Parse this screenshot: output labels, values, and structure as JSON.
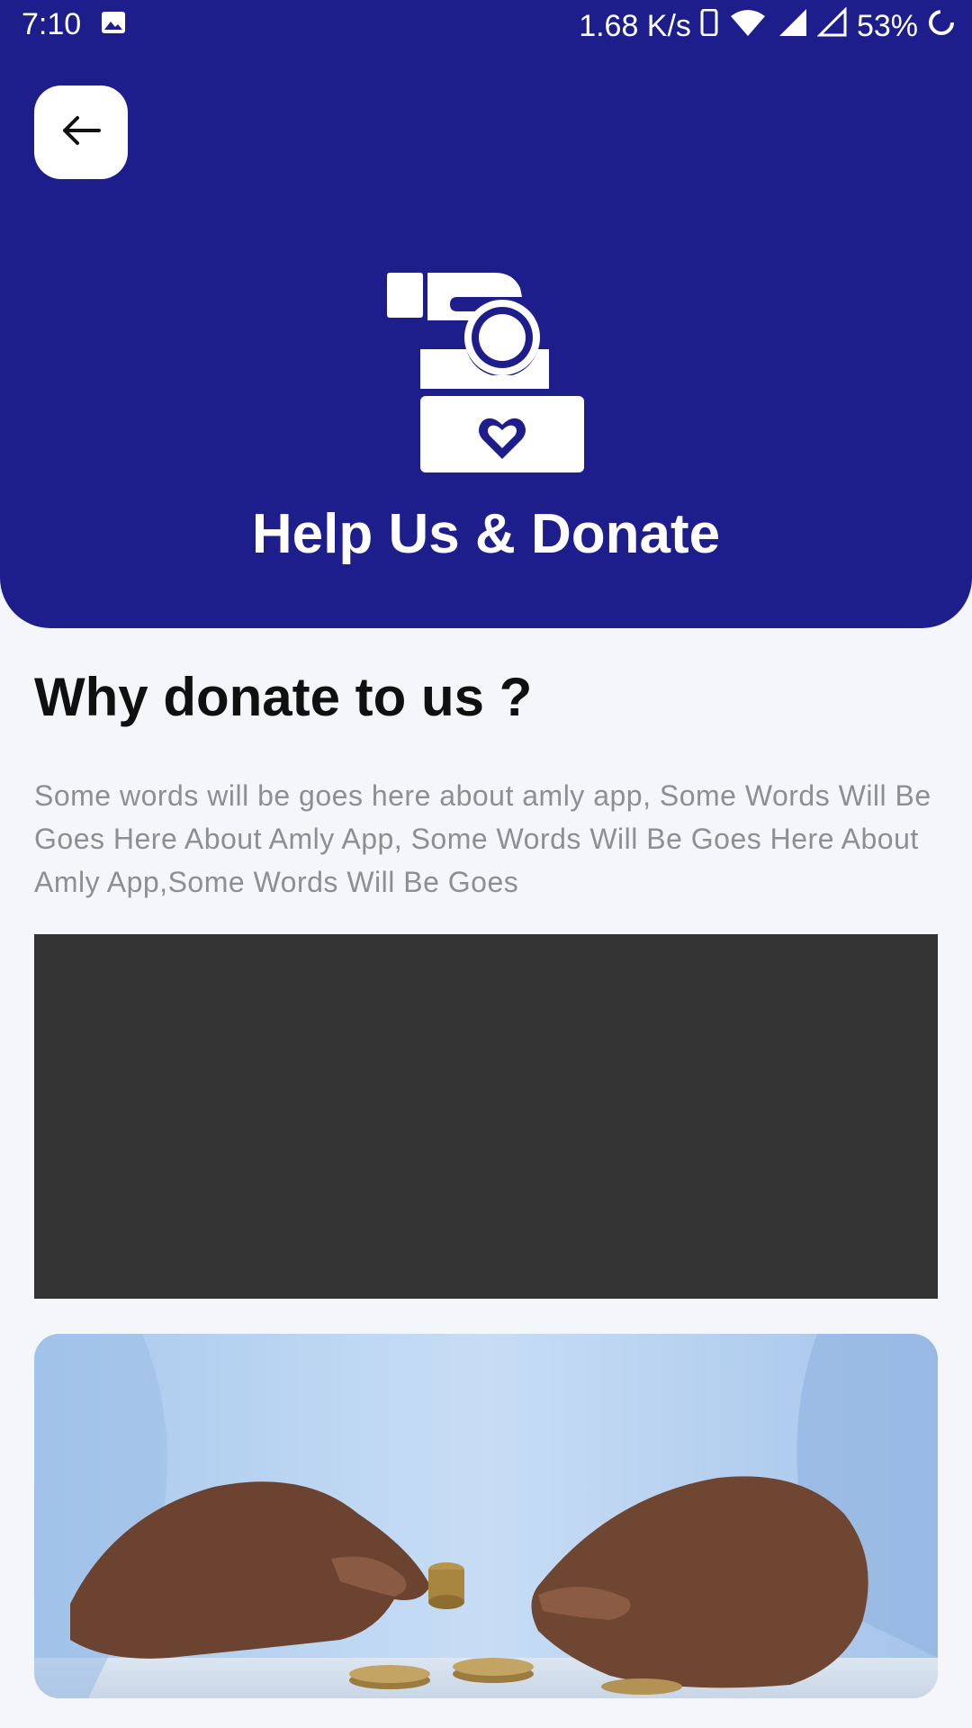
{
  "status_bar": {
    "time": "7:10",
    "network_speed": "1.68 K/s",
    "battery_percent": "53%",
    "icons": [
      "image-icon",
      "phone-icon",
      "wifi-icon",
      "signal-icon",
      "signal-icon",
      "battery-icon"
    ]
  },
  "header": {
    "back_icon": "arrow-left-icon",
    "hero_icon": "donation-box-icon",
    "title": "Help Us & Donate"
  },
  "content": {
    "heading": "Why donate to us ?",
    "description": "Some words will be goes here about amly app, Some Words Will Be Goes Here About Amly App, Some Words Will Be Goes Here About Amly App,Some Words Will Be Goes"
  },
  "media": {
    "video_placeholder": "video-player",
    "photo": "hands-stacking-coins-photo"
  },
  "colors": {
    "brand": "#1D1D8C",
    "background": "#F5F6F9",
    "text_primary": "#101010",
    "text_secondary": "#8E8E93",
    "video_bg": "#333333"
  }
}
